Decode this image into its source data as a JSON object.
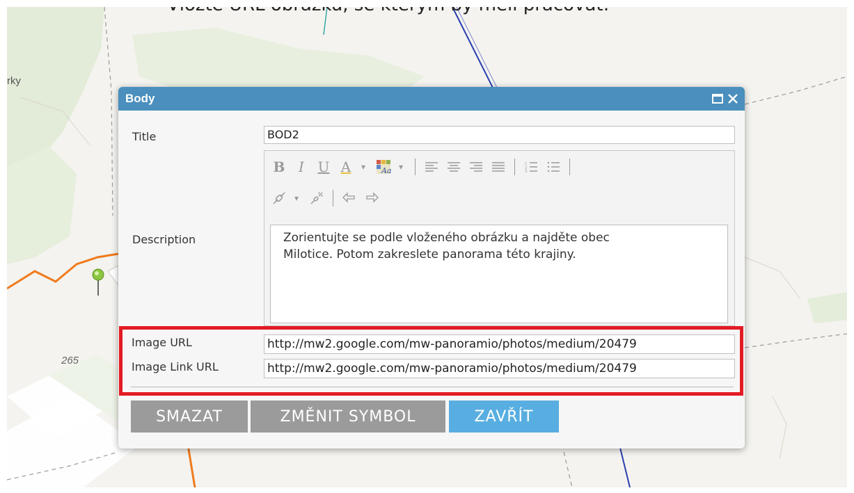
{
  "caption": "Vložte URL obrázku, se kterým by měli pracovat:",
  "map": {
    "place_label": "rky",
    "elevation_label": "265"
  },
  "dialog": {
    "title": "Body",
    "fields": {
      "title_label": "Title",
      "title_value": "BOD2",
      "description_label": "Description",
      "description_line1": "Zorientujte se podle vloženého obrázku a najděte obec",
      "description_line2": "Milotice. Potom zakreslete panorama této krajiny.",
      "image_url_label": "Image URL",
      "image_url_value": "http://mw2.google.com/mw-panoramio/photos/medium/20479",
      "image_link_url_label": "Image Link URL",
      "image_link_url_value": "http://mw2.google.com/mw-panoramio/photos/medium/20479"
    },
    "toolbar": {
      "bold": "B",
      "italic": "I",
      "underline": "U",
      "font_color": "A",
      "dropdown": "▾"
    },
    "buttons": {
      "delete": "SMAZAT",
      "change_symbol": "ZMĚNIT SYMBOL",
      "close": "ZAVŘÍT"
    }
  },
  "colors": {
    "titlebar": "#4a8fbd",
    "highlight": "#e31b23",
    "button_gray": "#9b9b9b",
    "button_blue": "#58aee0",
    "route": "#f07a1c"
  },
  "icons": [
    "maximize-icon",
    "close-icon",
    "font-background-color-icon",
    "align-left-icon",
    "align-center-icon",
    "align-right-icon",
    "justify-icon",
    "ordered-list-icon",
    "unordered-list-icon",
    "link-icon",
    "unlink-icon",
    "undo-icon",
    "redo-icon",
    "map-pin-icon"
  ]
}
